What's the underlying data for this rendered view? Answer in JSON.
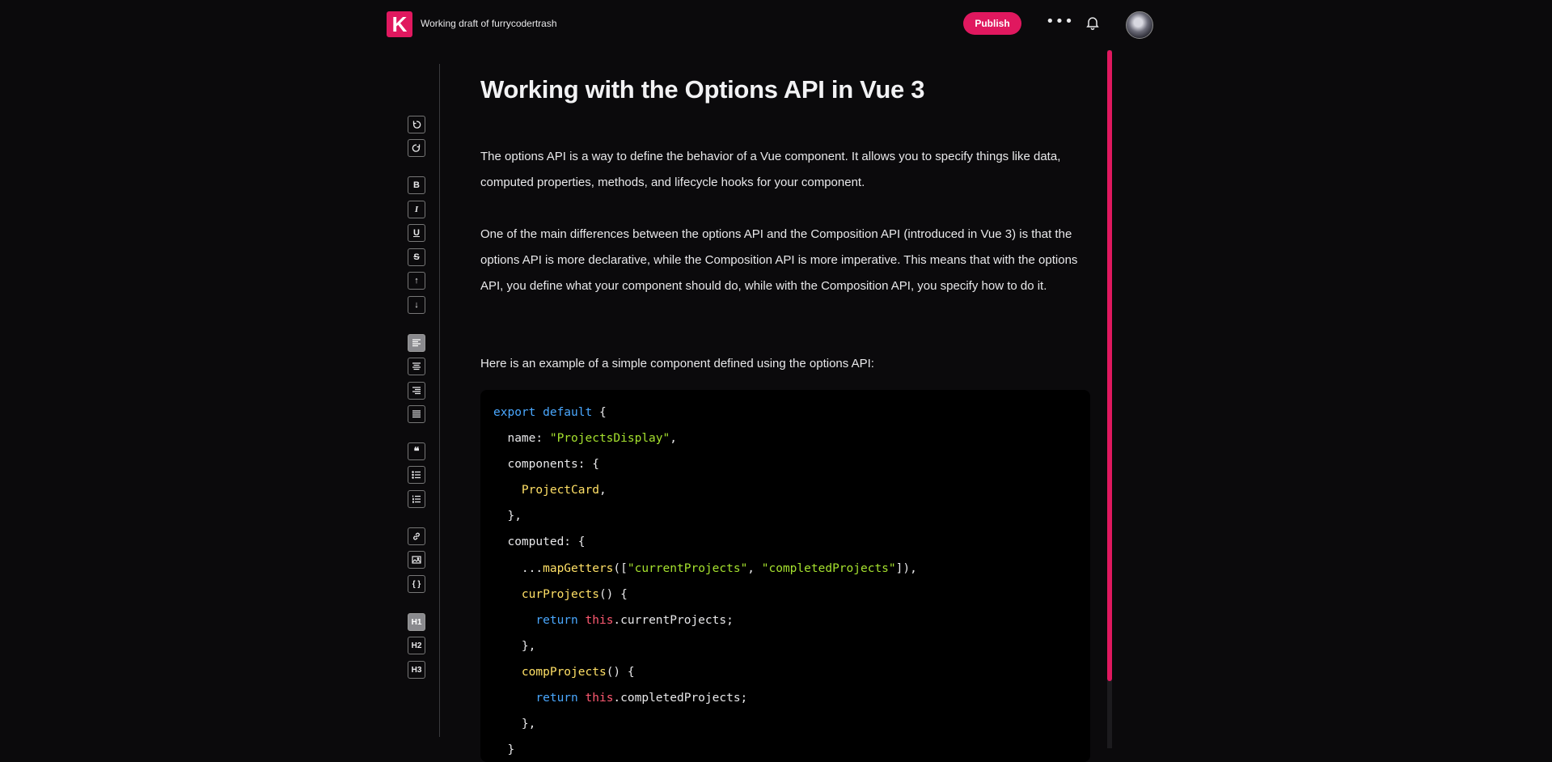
{
  "header": {
    "logo_letter": "K",
    "draft_title": "Working draft of furrycodertrash",
    "publish_label": "Publish",
    "more_label": "•••",
    "accent": "#e0185f"
  },
  "toolbar": {
    "bold": "B",
    "italic": "I",
    "underline": "U",
    "strike": "S",
    "superscript": "↑",
    "subscript": "↓",
    "quote": "❝",
    "code_block": "{ }",
    "h1": "H1",
    "h2": "H2",
    "h3": "H3",
    "icons": [
      "undo-icon",
      "redo-icon",
      "bold-icon",
      "italic-icon",
      "underline-icon",
      "strikethrough-icon",
      "arrow-up-icon",
      "arrow-down-icon",
      "align-left-icon",
      "align-center-icon",
      "align-right-icon",
      "align-justify-icon",
      "quote-icon",
      "bullet-list-icon",
      "numbered-list-icon",
      "link-icon",
      "image-icon",
      "code-block-icon"
    ]
  },
  "article": {
    "title": "Working with the Options API in Vue 3",
    "p1": "The options API is a way to define the behavior of a Vue component. It allows you to specify things like data, computed properties, methods, and lifecycle hooks for your component.",
    "p2": "One of the main differences between the options API and the Composition API (introduced in Vue 3) is that the options API is more declarative, while the Composition API is more imperative. This means that with the options API, you define what your component should do, while with the Composition API, you specify how to do it.",
    "p3": "Here is an example of a simple component defined using the options API:",
    "code": {
      "l1_kw": "export default",
      "l1_rest": " {",
      "l2_key": "  name: ",
      "l2_str": "\"ProjectsDisplay\"",
      "l2_rest": ",",
      "l3": "  components: {",
      "l4_fn": "    ProjectCard",
      "l4_rest": ",",
      "l5": "  },",
      "l6": "  computed: {",
      "l7_pre": "    ...",
      "l7_fn": "mapGetters",
      "l7_a": "([",
      "l7_s1": "\"currentProjects\"",
      "l7_b": ", ",
      "l7_s2": "\"completedProjects\"",
      "l7_c": "]),",
      "l8_fn": "    curProjects",
      "l8_rest": "() {",
      "l9_kw": "      return ",
      "l9_th": "this",
      "l9_rest": ".currentProjects;",
      "l10": "    },",
      "l11_fn": "    compProjects",
      "l11_rest": "() {",
      "l12_kw": "      return ",
      "l12_th": "this",
      "l12_rest": ".completedProjects;",
      "l13": "    },",
      "l14": "  }"
    }
  }
}
